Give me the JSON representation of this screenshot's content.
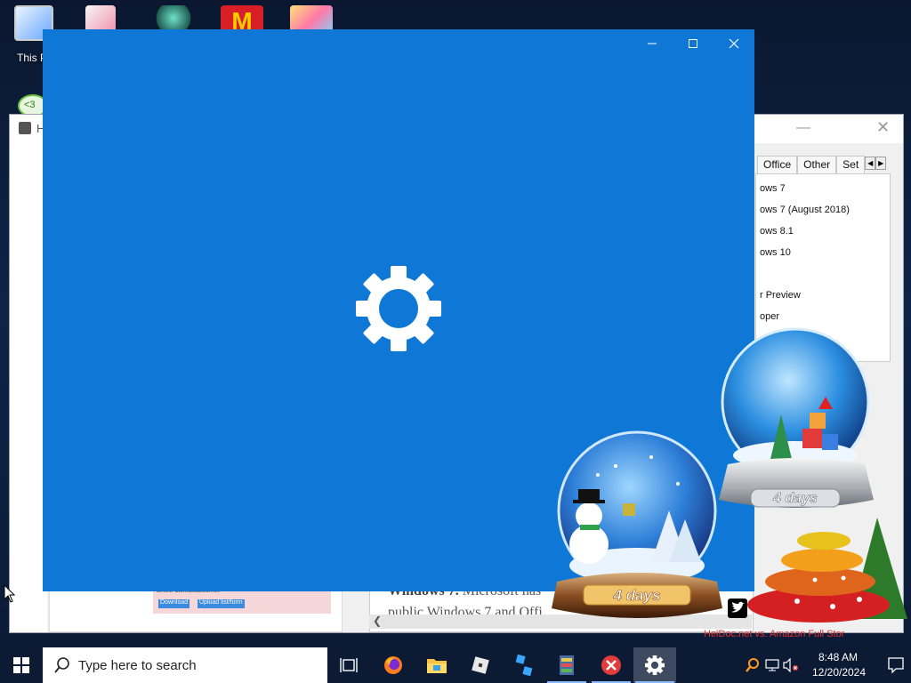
{
  "desktop": {
    "icons": [
      {
        "name": "this-pc-icon",
        "label": "This P"
      },
      {
        "name": "photo-app-icon",
        "label": ""
      },
      {
        "name": "game-character-icon",
        "label": ""
      },
      {
        "name": "mcdonalds-icon",
        "label": ""
      },
      {
        "name": "cartoon-game-icon",
        "label": ""
      }
    ],
    "second_row_icon_label": "<3"
  },
  "background_window": {
    "title_fragment": "H",
    "tabs": [
      "Office",
      "Other",
      "Set"
    ],
    "list_items": [
      "ows 7",
      "ows 7 (August 2018)",
      "ows 8.1",
      "ows 10",
      "r Preview",
      "oper"
    ],
    "article_heading": "Windows 7.",
    "article_line1": "Microsoft has",
    "article_line2": "public Windows 7 and Offi",
    "ad_text": "Lines: alsmallsales.net",
    "ad_btn1": "Download",
    "ad_btn2": "Upload list/form",
    "footer_left": "HeiDoc.net",
    "footer_sep": " vs. ",
    "footer_right": "Amazon Full Stor"
  },
  "splash_window": {
    "app": "Settings",
    "icon": "gear-icon",
    "background_color": "#0f78d7"
  },
  "globes": [
    {
      "label": "4 days"
    },
    {
      "label": "4 days"
    }
  ],
  "taskbar": {
    "search_placeholder": "Type here to search",
    "apps": [
      {
        "name": "task-view-icon"
      },
      {
        "name": "firefox-icon"
      },
      {
        "name": "file-explorer-icon"
      },
      {
        "name": "roblox-icon"
      },
      {
        "name": "roblox-studio-icon"
      },
      {
        "name": "archive-app-icon"
      },
      {
        "name": "close-app-icon"
      },
      {
        "name": "settings-icon",
        "active": true
      }
    ],
    "clock_time": "8:48 AM",
    "clock_date": "12/20/2024"
  }
}
